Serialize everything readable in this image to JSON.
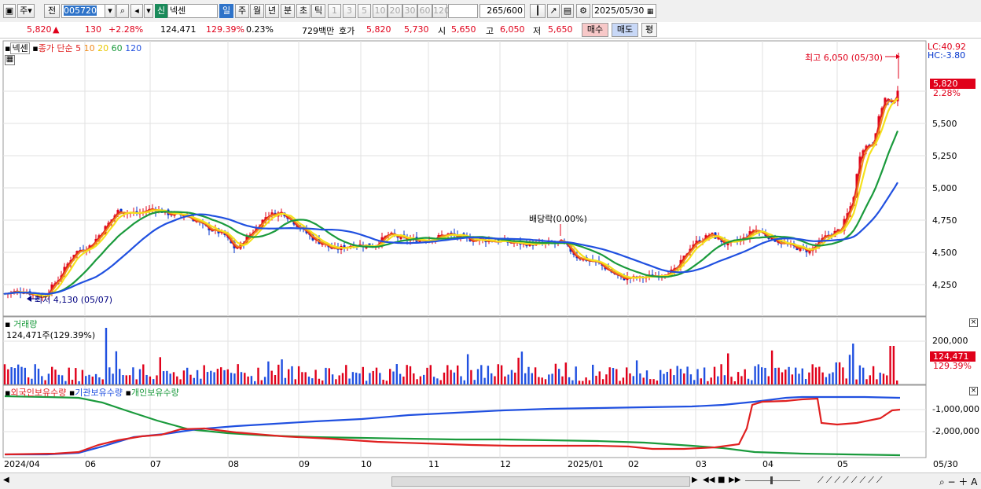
{
  "toolbar": {
    "period_label": "주",
    "prev_label": "전",
    "code": "005720",
    "stock_badge": "신",
    "stock_name": "넥센",
    "period_tabs": [
      "일",
      "주",
      "월",
      "년",
      "분",
      "초",
      "틱"
    ],
    "interval_buttons": [
      "1",
      "3",
      "5",
      "10",
      "20",
      "30",
      "60",
      "120"
    ],
    "count": "265",
    "count_total": "/600",
    "date": "2025/05/30"
  },
  "quote": {
    "price": "5,820",
    "arrow": "▲",
    "change": "130",
    "change_pct": "+2.28%",
    "volume": "124,471",
    "volume_ratio": "129.39%",
    "turnover_pct": "0.23%",
    "amount": "729백만",
    "bid_label": "호가",
    "ask": "5,820",
    "bid": "5,730",
    "open_label": "시",
    "open": "5,650",
    "high_label": "고",
    "high": "6,050",
    "low_label": "저",
    "low": "5,650",
    "buy_button": "매수",
    "sell_button": "매도",
    "eval_button": "평"
  },
  "price_panel": {
    "stock_tag": "넥센",
    "legend_name": "종가 단순",
    "ma_periods": [
      "5",
      "10",
      "20",
      "60",
      "120"
    ],
    "ma_colors": [
      "#e02020",
      "#f08a1c",
      "#f5e21c",
      "#1a9a3c",
      "#2050e0"
    ],
    "lc": "LC:40.92",
    "hc": "HC:-3.80",
    "max_label": "최고 6,050 (05/30)",
    "min_label": "최저 4,130 (05/07)",
    "dividend_label": "배당락(0.00%)",
    "current_price_tag": "5,820",
    "current_pct_tag": "2.28%",
    "y_ticks": [
      "5,500",
      "5,250",
      "5,000",
      "4,750",
      "4,500",
      "4,250"
    ]
  },
  "volume_panel": {
    "title": "거래량",
    "value_label": "124,471주(129.39%)",
    "y_tick": "200,000",
    "current_tag": "124,471",
    "current_pct": "129.39%"
  },
  "holdings_panel": {
    "series": [
      "외국인보유수량",
      "기관보유수량",
      "개인보유수량"
    ],
    "y_ticks": [
      "-1,000,000",
      "-2,000,000"
    ]
  },
  "x_axis": {
    "labels": [
      "2024/04",
      "06",
      "07",
      "08",
      "09",
      "10",
      "11",
      "12",
      "2025/01",
      "02",
      "03",
      "04",
      "05",
      "05/30"
    ]
  },
  "colors": {
    "up": "#e0001a",
    "down": "#0033cc",
    "grid": "#d8d8d8"
  },
  "chart_data": {
    "type": "line",
    "title": "",
    "y_range_price": [
      4100,
      6100
    ],
    "series": [
      {
        "name": "외국인보유수량",
        "color": "#e02020"
      },
      {
        "name": "기관보유수량",
        "color": "#2050e0"
      },
      {
        "name": "개인보유수량",
        "color": "#1a9a3c"
      }
    ]
  }
}
